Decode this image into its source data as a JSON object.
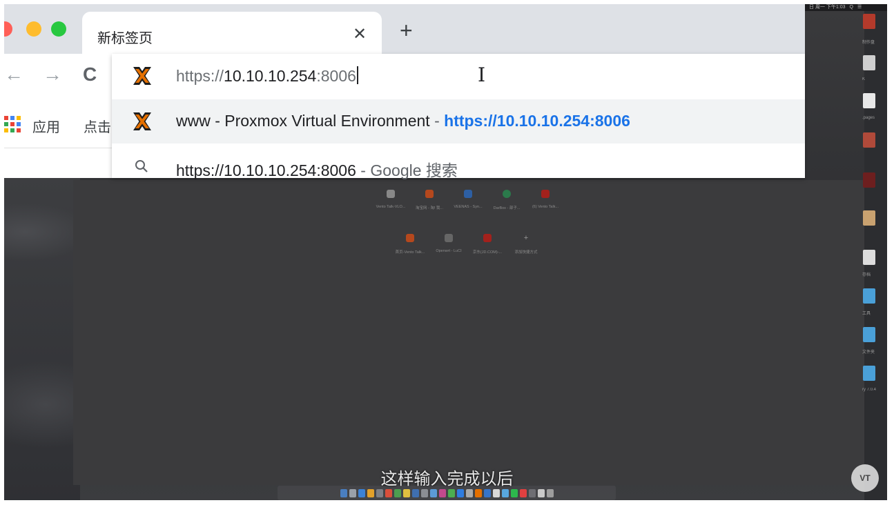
{
  "window": {
    "tab_title": "新标签页",
    "close_glyph": "✕",
    "new_tab_glyph": "+"
  },
  "toolbar": {
    "back_glyph": "←",
    "forward_glyph": "→",
    "reload_glyph": "C"
  },
  "bookmarks": {
    "apps_label": "应用",
    "item_2": "点击"
  },
  "omnibox": {
    "typed_prefix": "https://",
    "typed_host": "10.10.10.254",
    "typed_suffix": ":8006",
    "suggestion_title": "www - Proxmox Virtual Environment",
    "suggestion_sep": "-",
    "suggestion_url": "https://10.10.10.254:8006",
    "search_query": "https://10.10.10.254:8006",
    "search_provider": "Google 搜索"
  },
  "new_tab_page": {
    "tiles_row1": [
      "Vento Talk-VLO...",
      "淘宝网 - 淘! 我...",
      "VEENAS - Syn...",
      "DarBox - 部子...",
      "(6) Vento Talk..."
    ],
    "tiles_row2": [
      "首页-Vento Talk...",
      "Openwrt - LuCI",
      "京东(JD.COM)-...",
      "添加快捷方式"
    ]
  },
  "desktop": {
    "right_labels": [
      "制作盘",
      "K",
      ".pages",
      "存档",
      "工具",
      "文件夹",
      "ry 7.0.4"
    ]
  },
  "overlay": {
    "subtitle": "这样输入完成以后",
    "watermark": "VT"
  },
  "colors": {
    "tabstrip": "#dee1e6",
    "link_blue": "#1a73e8",
    "proxmox_orange": "#e57000",
    "traffic_red": "#ff5f57",
    "traffic_yellow": "#febc2e",
    "traffic_green": "#28c840"
  },
  "icons": [
    "apps-grid-icon",
    "proxmox-icon",
    "search-icon",
    "text-cursor-icon"
  ]
}
